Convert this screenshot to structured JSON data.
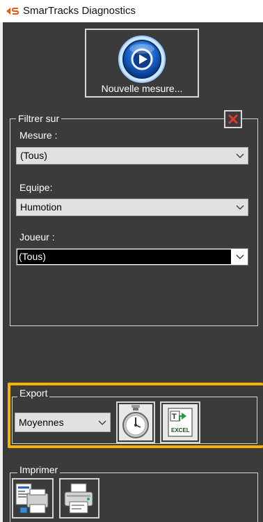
{
  "window": {
    "title": "SmarTracks Diagnostics",
    "logo_text": "◀S"
  },
  "toolbar": {
    "new_measure_label": "Nouvelle mesure..."
  },
  "filter": {
    "legend": "Filtrer sur",
    "mesure": {
      "label": "Mesure :",
      "value": "(Tous)"
    },
    "equipe": {
      "label": "Equipe:",
      "value": "Humotion"
    },
    "joueur": {
      "label": "Joueur :",
      "value": "(Tous)"
    }
  },
  "export": {
    "legend": "Export",
    "format": {
      "value": "Moyennes"
    },
    "excel_text": "EXCEL"
  },
  "print": {
    "legend": "Imprimer"
  },
  "colors": {
    "panel": "#3b3b3b",
    "highlight": "#f5b301",
    "close": "#e23a2a",
    "play": "#1a63c8"
  }
}
